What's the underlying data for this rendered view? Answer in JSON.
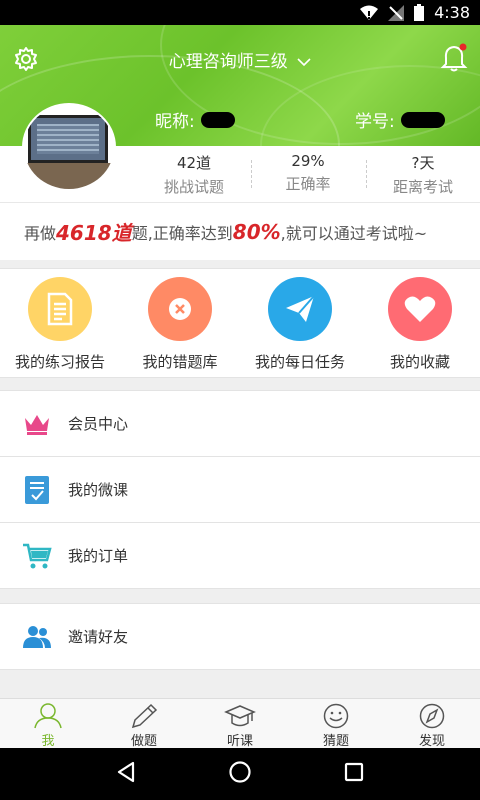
{
  "status_bar": {
    "time": "4:38"
  },
  "header": {
    "title": "心理咨询师三级",
    "nickname_label": "昵称:",
    "student_id_label": "学号:"
  },
  "stats": [
    {
      "value": "42道",
      "label": "挑战试题"
    },
    {
      "value": "29%",
      "label": "正确率"
    },
    {
      "value": "?天",
      "label": "距离考试"
    }
  ],
  "goal": {
    "prefix": "再做",
    "count": "4618道",
    "middle": "题,正确率达到",
    "rate": "80%",
    "suffix": ",就可以通过考试啦~"
  },
  "quick_actions": [
    {
      "label": "我的练习报告",
      "icon": "report-icon",
      "color": "#ffd466"
    },
    {
      "label": "我的错题库",
      "icon": "wrong-icon",
      "color": "#ff8a65"
    },
    {
      "label": "我的每日任务",
      "icon": "paper-plane-icon",
      "color": "#29a8e8"
    },
    {
      "label": "我的收藏",
      "icon": "heart-icon",
      "color": "#ff6b73"
    }
  ],
  "menu_group1": [
    {
      "label": "会员中心",
      "icon": "crown-icon"
    },
    {
      "label": "我的微课",
      "icon": "checklist-icon"
    },
    {
      "label": "我的订单",
      "icon": "cart-icon"
    }
  ],
  "menu_group2": [
    {
      "label": "邀请好友",
      "icon": "friends-icon"
    }
  ],
  "tabs": [
    {
      "label": "我",
      "icon": "person-icon",
      "active": true
    },
    {
      "label": "做题",
      "icon": "pen-icon",
      "active": false
    },
    {
      "label": "听课",
      "icon": "graduation-cap-icon",
      "active": false
    },
    {
      "label": "猜题",
      "icon": "smile-icon",
      "active": false
    },
    {
      "label": "发现",
      "icon": "compass-icon",
      "active": false
    }
  ],
  "colors": {
    "accent": "#7ab72e",
    "highlight_red": "#d8262a"
  }
}
